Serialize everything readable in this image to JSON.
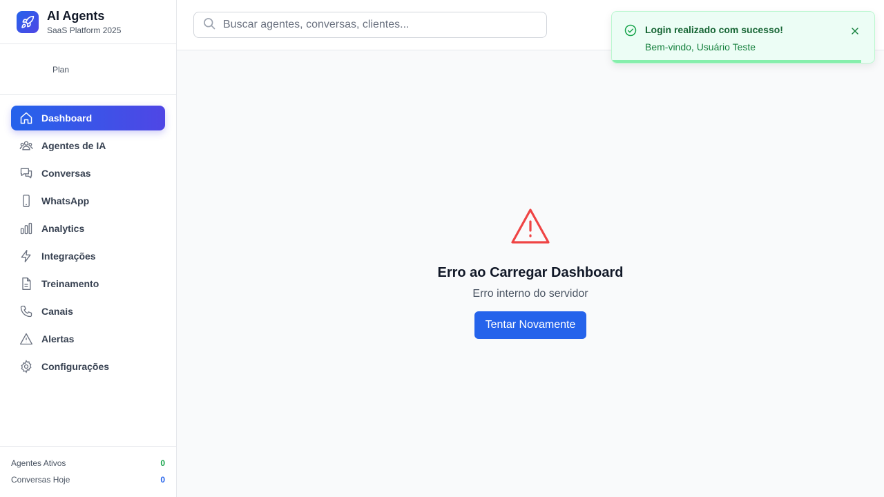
{
  "brand": {
    "title": "AI Agents",
    "subtitle": "SaaS Platform 2025"
  },
  "plan": {
    "label": "Plan"
  },
  "nav": [
    {
      "label": "Dashboard",
      "icon": "home-icon",
      "active": true
    },
    {
      "label": "Agentes de IA",
      "icon": "users-icon"
    },
    {
      "label": "Conversas",
      "icon": "chat-icon"
    },
    {
      "label": "WhatsApp",
      "icon": "phone-device-icon"
    },
    {
      "label": "Analytics",
      "icon": "bar-chart-icon"
    },
    {
      "label": "Integrações",
      "icon": "bolt-icon"
    },
    {
      "label": "Treinamento",
      "icon": "document-icon"
    },
    {
      "label": "Canais",
      "icon": "phone-icon"
    },
    {
      "label": "Alertas",
      "icon": "alert-icon"
    },
    {
      "label": "Configurações",
      "icon": "gear-icon"
    }
  ],
  "stats": [
    {
      "label": "Agentes Ativos",
      "value": "0",
      "color": "#16a34a"
    },
    {
      "label": "Conversas Hoje",
      "value": "0",
      "color": "#2563eb"
    }
  ],
  "search": {
    "placeholder": "Buscar agentes, conversas, clientes..."
  },
  "error": {
    "title": "Erro ao Carregar Dashboard",
    "message": "Erro interno do servidor",
    "button": "Tentar Novamente"
  },
  "toast": {
    "title": "Login realizado com sucesso!",
    "message": "Bem-vindo, Usuário Teste",
    "progress": 0.95
  },
  "colors": {
    "primary": "#2563eb",
    "accent": "#4f46e5",
    "success": "#16a34a",
    "danger": "#ef4444"
  }
}
